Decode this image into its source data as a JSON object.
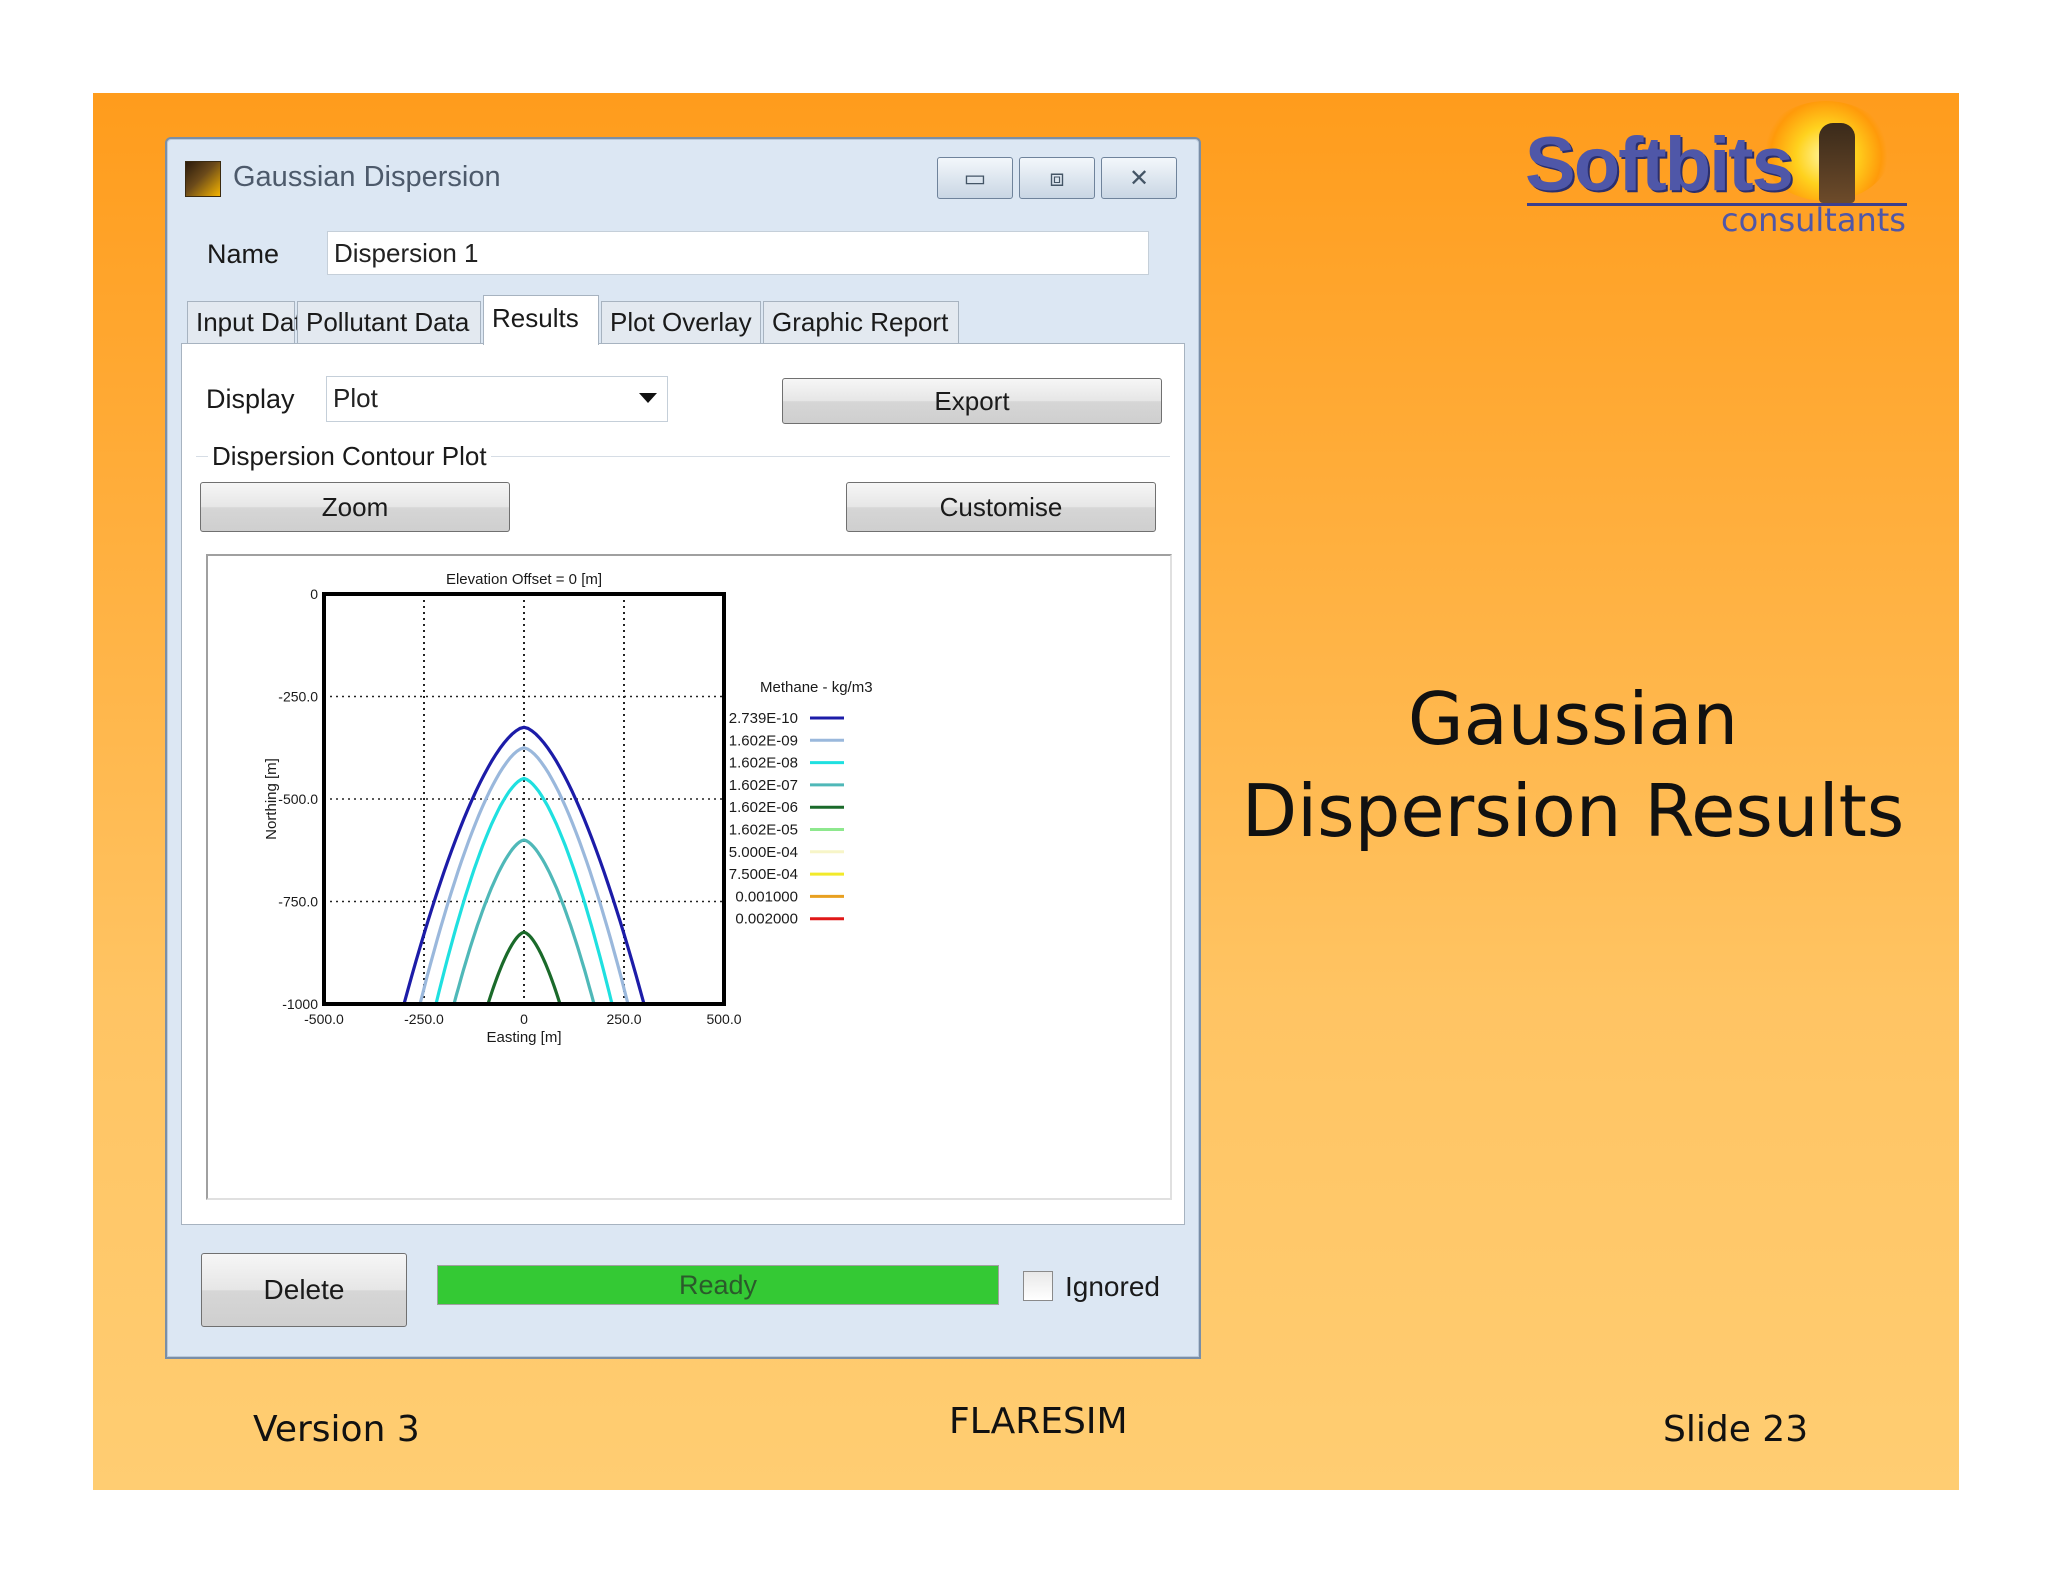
{
  "window": {
    "title": "Gaussian Dispersion",
    "min_glyph": "▭",
    "max_glyph": "⧈",
    "close_glyph": "✕"
  },
  "name_field": {
    "label": "Name",
    "value": "Dispersion 1"
  },
  "tabs": [
    {
      "label": "Input Data"
    },
    {
      "label": "Pollutant Data"
    },
    {
      "label": "Results",
      "active": true
    },
    {
      "label": "Plot Overlay"
    },
    {
      "label": "Graphic Report"
    }
  ],
  "display": {
    "label": "Display",
    "selected": "Plot"
  },
  "buttons": {
    "export": "Export",
    "zoom": "Zoom",
    "customise": "Customise",
    "delete": "Delete"
  },
  "group_label": "Dispersion Contour Plot",
  "status": {
    "text": "Ready",
    "progress": 1.0,
    "color": "#34c934"
  },
  "ignored": {
    "label": "Ignored",
    "checked": false
  },
  "chart_data": {
    "type": "line",
    "title": "Elevation Offset = 0 [m]",
    "xlabel": "Easting [m]",
    "ylabel": "Northing [m]",
    "xlim": [
      -500,
      500
    ],
    "ylim": [
      -1000,
      0
    ],
    "xticks": [
      "-500.0",
      "-250.0",
      "0",
      "250.0",
      "500.0"
    ],
    "yticks": [
      "0",
      "-250.0",
      "-500.0",
      "-750.0",
      "-1000"
    ],
    "grid": true,
    "legend_title": "Methane - kg/m3",
    "legend_position": "right",
    "series": [
      {
        "name": "2.739E-10",
        "color": "#1c1ca8",
        "apex_y": -325,
        "base_halfwidth": 300
      },
      {
        "name": "1.602E-09",
        "color": "#9ab8dc",
        "apex_y": -375,
        "base_halfwidth": 260
      },
      {
        "name": "1.602E-08",
        "color": "#1fe0e0",
        "apex_y": -450,
        "base_halfwidth": 220
      },
      {
        "name": "1.602E-07",
        "color": "#4fb8b8",
        "apex_y": -600,
        "base_halfwidth": 175
      },
      {
        "name": "1.602E-06",
        "color": "#1a6a2a",
        "apex_y": -825,
        "base_halfwidth": 90
      },
      {
        "name": "1.602E-05",
        "color": "#8ee88e",
        "apex_y": null,
        "base_halfwidth": null
      },
      {
        "name": "5.000E-04",
        "color": "#f7f5c8",
        "apex_y": null,
        "base_halfwidth": null
      },
      {
        "name": "7.500E-04",
        "color": "#f2ea2a",
        "apex_y": null,
        "base_halfwidth": null
      },
      {
        "name": "0.001000",
        "color": "#e8a020",
        "apex_y": null,
        "base_halfwidth": null
      },
      {
        "name": "0.002000",
        "color": "#e01818",
        "apex_y": null,
        "base_halfwidth": null
      }
    ]
  },
  "logo": {
    "name": "Softbits",
    "sub": "consultants"
  },
  "slide": {
    "title_line1": "Gaussian",
    "title_line2": "Dispersion Results",
    "footer_left": "Version 3",
    "footer_center": "FLARESIM",
    "footer_right": "Slide 23"
  }
}
